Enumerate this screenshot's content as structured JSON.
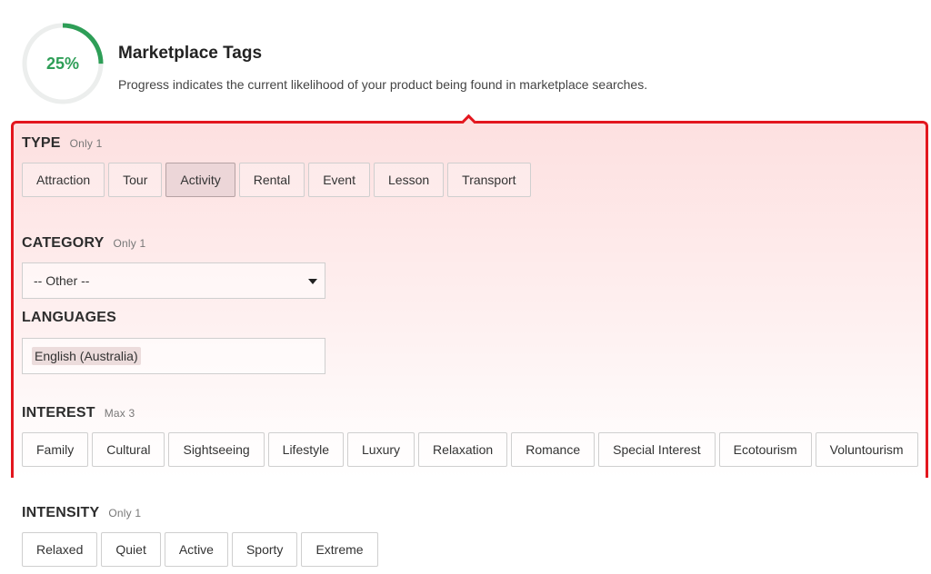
{
  "header": {
    "progress_text": "25%",
    "progress_fraction": 0.25,
    "title": "Marketplace Tags",
    "subtitle": "Progress indicates the current likelihood of your product being found in marketplace searches."
  },
  "colors": {
    "progress": "#2e9e57",
    "highlight_border": "#e3161e",
    "selected_chip": "#ecd6d8"
  },
  "type": {
    "label": "TYPE",
    "hint": "Only 1",
    "options": [
      "Attraction",
      "Tour",
      "Activity",
      "Rental",
      "Event",
      "Lesson",
      "Transport"
    ],
    "selected": "Activity"
  },
  "category": {
    "label": "CATEGORY",
    "hint": "Only 1",
    "value": "-- Other --",
    "icon": "caret-down-icon"
  },
  "languages": {
    "label": "LANGUAGES",
    "tags": [
      "English (Australia)"
    ]
  },
  "interest": {
    "label": "INTEREST",
    "hint": "Max 3",
    "options": [
      "Family",
      "Cultural",
      "Sightseeing",
      "Lifestyle",
      "Luxury",
      "Relaxation",
      "Romance",
      "Special Interest",
      "Ecotourism",
      "Voluntourism"
    ]
  },
  "intensity": {
    "label": "INTENSITY",
    "hint": "Only 1",
    "options": [
      "Relaxed",
      "Quiet",
      "Active",
      "Sporty",
      "Extreme"
    ]
  }
}
